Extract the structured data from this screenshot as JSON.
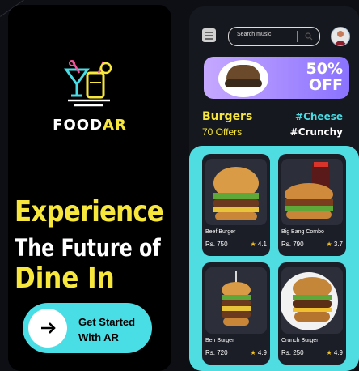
{
  "left_screen": {
    "brand_part1": "FOOD",
    "brand_part2": "AR",
    "headline_1": "Experience",
    "headline_2": "The Future of",
    "headline_3": "Dine In",
    "cta_label_line1": "Get Started",
    "cta_label_line2": "With AR"
  },
  "right_screen": {
    "search_placeholder": "Search music",
    "banner": {
      "discount": "50%",
      "discount_word": "OFF"
    },
    "category_title": "Burgers",
    "offers_count": "70 Offers",
    "tags": [
      "#Cheese",
      "#Crunchy"
    ],
    "products": [
      {
        "name": "Beef Burger",
        "price": "Rs. 750",
        "rating": "4.1"
      },
      {
        "name": "Big Bang Combo",
        "price": "Rs. 790",
        "rating": "3.7"
      },
      {
        "name": "Ben Burger",
        "price": "Rs. 720",
        "rating": "4.9"
      },
      {
        "name": "Crunch Burger",
        "price": "Rs. 250",
        "rating": "4.9"
      }
    ]
  },
  "colors": {
    "accent_yellow": "#f7e73d",
    "accent_cyan": "#49dde6",
    "card_bg": "#1c1e27"
  },
  "icons": [
    "cocktail-logo-icon",
    "arrow-right-icon",
    "menu-icon",
    "search-icon",
    "star-icon"
  ]
}
